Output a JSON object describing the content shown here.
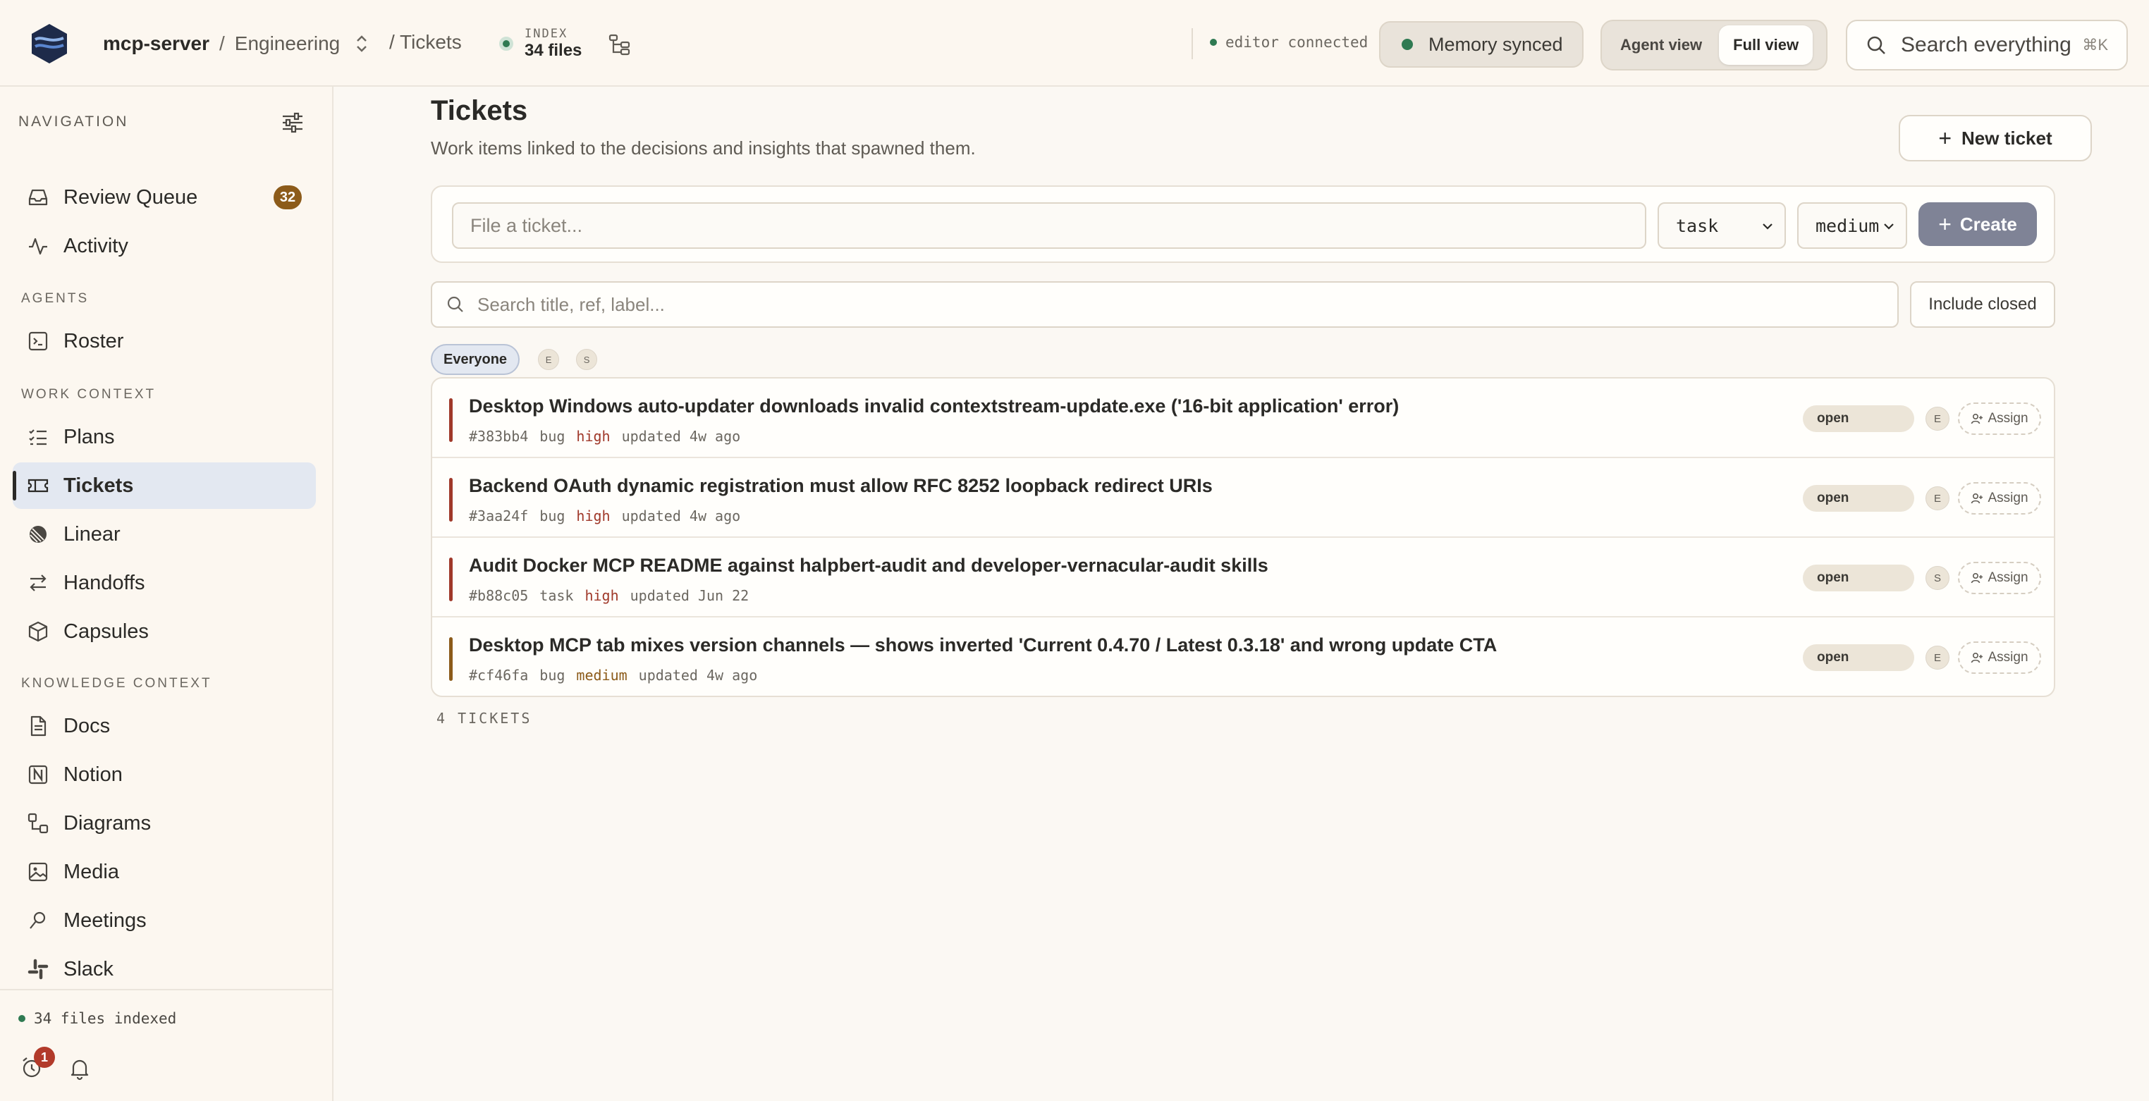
{
  "header": {
    "project": "mcp-server",
    "team": "Engineering",
    "page": "/ Tickets",
    "index_label": "INDEX",
    "index_count": "34 files",
    "editor_status": "editor connected",
    "memory_status": "Memory synced",
    "view_agent": "Agent view",
    "view_full": "Full view",
    "search_placeholder": "Search everything",
    "search_shortcut": "⌘K"
  },
  "sidebar": {
    "heading": "NAVIGATION",
    "top_items": [
      {
        "label": "Review Queue",
        "badge": "32",
        "icon": "inbox-icon"
      },
      {
        "label": "Activity",
        "icon": "activity-icon"
      }
    ],
    "agents_label": "AGENTS",
    "agents_items": [
      {
        "label": "Roster",
        "icon": "roster-icon"
      }
    ],
    "work_label": "WORK CONTEXT",
    "work_items": [
      {
        "label": "Plans",
        "icon": "checklist-icon"
      },
      {
        "label": "Tickets",
        "icon": "ticket-icon",
        "active": true
      },
      {
        "label": "Linear",
        "icon": "linear-icon"
      },
      {
        "label": "Handoffs",
        "icon": "swap-icon"
      },
      {
        "label": "Capsules",
        "icon": "box-icon"
      }
    ],
    "knowledge_label": "KNOWLEDGE CONTEXT",
    "knowledge_items": [
      {
        "label": "Docs",
        "icon": "doc-icon"
      },
      {
        "label": "Notion",
        "icon": "notion-icon"
      },
      {
        "label": "Diagrams",
        "icon": "diagram-icon"
      },
      {
        "label": "Media",
        "icon": "image-icon"
      },
      {
        "label": "Meetings",
        "icon": "mic-icon"
      },
      {
        "label": "Slack",
        "icon": "slack-icon"
      }
    ],
    "footer_status": "34 files indexed",
    "alarm_badge": "1"
  },
  "main": {
    "title": "Tickets",
    "subtitle": "Work items linked to the decisions and insights that spawned them.",
    "new_ticket": "New ticket",
    "file_placeholder": "File a ticket...",
    "type_select": "task",
    "priority_select": "medium",
    "create_label": "Create",
    "search_placeholder": "Search title, ref, label...",
    "include_closed": "Include closed",
    "filter_everyone": "Everyone",
    "filter_avatars": [
      "E",
      "S"
    ],
    "count_label": "4 TICKETS",
    "colors": {
      "high": "#a0392a",
      "medium": "#8c5b1a",
      "accent": "#7f8396"
    },
    "tickets": [
      {
        "title": "Desktop Windows auto-updater downloads invalid contextstream-update.exe ('16-bit application' error)",
        "ref": "#383bb4",
        "type": "bug",
        "priority": "high",
        "updated": "updated 4w ago",
        "status": "open",
        "assignee": "E",
        "assign_label": "Assign"
      },
      {
        "title": "Backend OAuth dynamic registration must allow RFC 8252 loopback redirect URIs",
        "ref": "#3aa24f",
        "type": "bug",
        "priority": "high",
        "updated": "updated 4w ago",
        "status": "open",
        "assignee": "E",
        "assign_label": "Assign"
      },
      {
        "title": "Audit Docker MCP README against halpbert-audit and developer-vernacular-audit skills",
        "ref": "#b88c05",
        "type": "task",
        "priority": "high",
        "updated": "updated Jun 22",
        "status": "open",
        "assignee": "S",
        "assign_label": "Assign"
      },
      {
        "title": "Desktop MCP tab mixes version channels — shows inverted 'Current 0.4.70 / Latest 0.3.18' and wrong update CTA",
        "ref": "#cf46fa",
        "type": "bug",
        "priority": "medium",
        "updated": "updated 4w ago",
        "status": "open",
        "assignee": "E",
        "assign_label": "Assign"
      }
    ]
  }
}
